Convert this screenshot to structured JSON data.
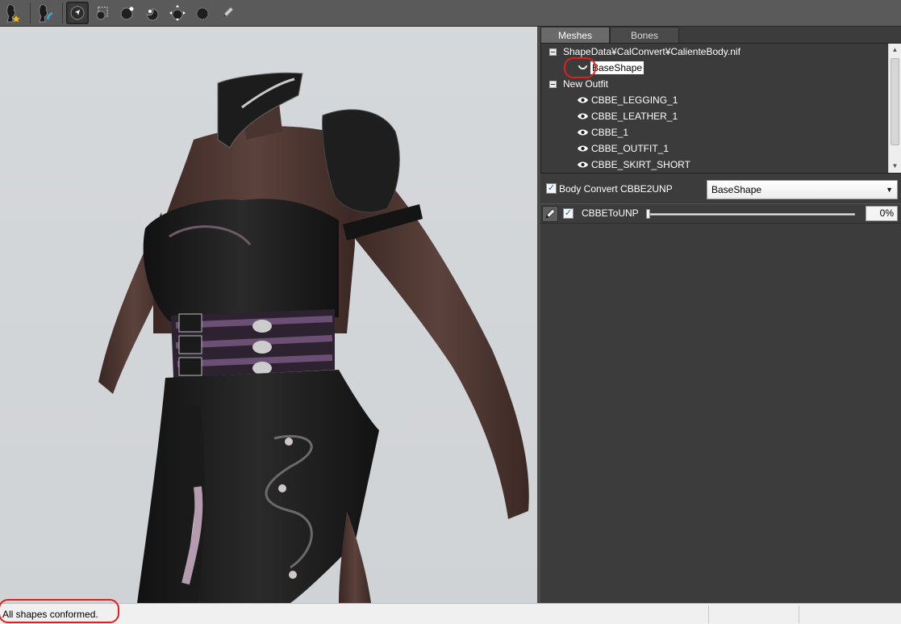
{
  "toolbar": {
    "buttons": [
      {
        "icon": "load-reference-icon",
        "active": false
      },
      {
        "icon": "load-outfit-icon",
        "active": false
      },
      {
        "icon": "select-brush-icon",
        "active": true
      },
      {
        "icon": "mask-brush-icon",
        "active": false
      },
      {
        "icon": "inflate-brush-icon",
        "active": false
      },
      {
        "icon": "deflate-brush-icon",
        "active": false
      },
      {
        "icon": "move-brush-icon",
        "active": false
      },
      {
        "icon": "smooth-brush-icon",
        "active": false
      },
      {
        "icon": "weight-brush-icon",
        "active": false
      }
    ]
  },
  "panel": {
    "tabs": [
      {
        "label": "Meshes",
        "active": true
      },
      {
        "label": "Bones",
        "active": false
      }
    ],
    "tree": {
      "reference_group": "ShapeData¥CalConvert¥CalienteBody.nif",
      "reference_shape": "BaseShape",
      "outfit_group": "New Outfit",
      "outfit_shapes": [
        "CBBE_LEGGING_1",
        "CBBE_LEATHER_1",
        "CBBE_1",
        "CBBE_OUTFIT_1",
        "CBBE_SKIRT_SHORT"
      ]
    },
    "conversion": {
      "checkbox_label": "Body Convert CBBE2UNP",
      "checked": true,
      "selected_shape": "BaseShape"
    },
    "slider": {
      "name": "CBBEToUNP",
      "checked": true,
      "value_text": "0%",
      "value": 0
    }
  },
  "status": {
    "message": "All shapes conformed."
  },
  "colors": {
    "panel_bg": "#3c3c3c",
    "viewport_bg": "#d3d6d9",
    "highlight_circle": "#e0201c",
    "selected_row_bg": "#ffffff"
  }
}
